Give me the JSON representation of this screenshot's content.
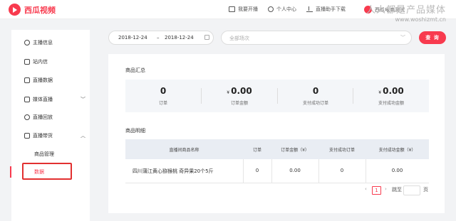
{
  "header": {
    "logo_text": "西瓜视频",
    "nav": {
      "start_live": "我要开播",
      "personal_center": "个人中心",
      "live_assistant_download": "直播助手下载"
    },
    "user_name": "西瓜电商测试"
  },
  "watermark": {
    "line1": "人人都是产品媒体",
    "line2": "www.woshizmt.cn"
  },
  "sidebar": {
    "items": [
      {
        "label": "主播信息",
        "icon": "user-circle-icon"
      },
      {
        "label": "站内信",
        "icon": "mail-icon"
      },
      {
        "label": "直播数据",
        "icon": "data-icon"
      },
      {
        "label": "媒体直播",
        "icon": "media-icon",
        "chevron": "﹀"
      },
      {
        "label": "直播回放",
        "icon": "replay-icon"
      },
      {
        "label": "直播带货",
        "icon": "cart-icon",
        "chevron": "︿"
      }
    ],
    "sub_items": {
      "goods_management": "商品管理",
      "data": "数据"
    },
    "active_color": "#f83a4e"
  },
  "filter": {
    "start_date": "2018-12-24",
    "separator": "–",
    "end_date": "2018-12-24",
    "scene_placeholder": "全部场次",
    "query_label": "查 询"
  },
  "summary": {
    "title": "商品汇总",
    "currency": "¥",
    "stats": [
      {
        "value": "0",
        "label": "订单"
      },
      {
        "value": "0.00",
        "label": "订单金额"
      },
      {
        "value": "0",
        "label": "支付成功订单"
      },
      {
        "value": "0.00",
        "label": "支付成功金额"
      }
    ]
  },
  "detail": {
    "title": "商品明细",
    "columns": [
      "直播间商品名称",
      "订单",
      "订单金额（¥）",
      "支付成功订单",
      "支付成功金额（¥）"
    ],
    "rows": [
      [
        "四川蒲江黄心猕猴桃 奇异果20个5斤",
        "0",
        "0.00",
        "0",
        "0.00"
      ]
    ]
  },
  "pagination": {
    "prev": "‹",
    "current": "1",
    "next": "›",
    "jump_label": "跳至",
    "page_unit": "页"
  },
  "colors": {
    "brand": "#f83a4e",
    "highlight_box": "#e23030"
  }
}
